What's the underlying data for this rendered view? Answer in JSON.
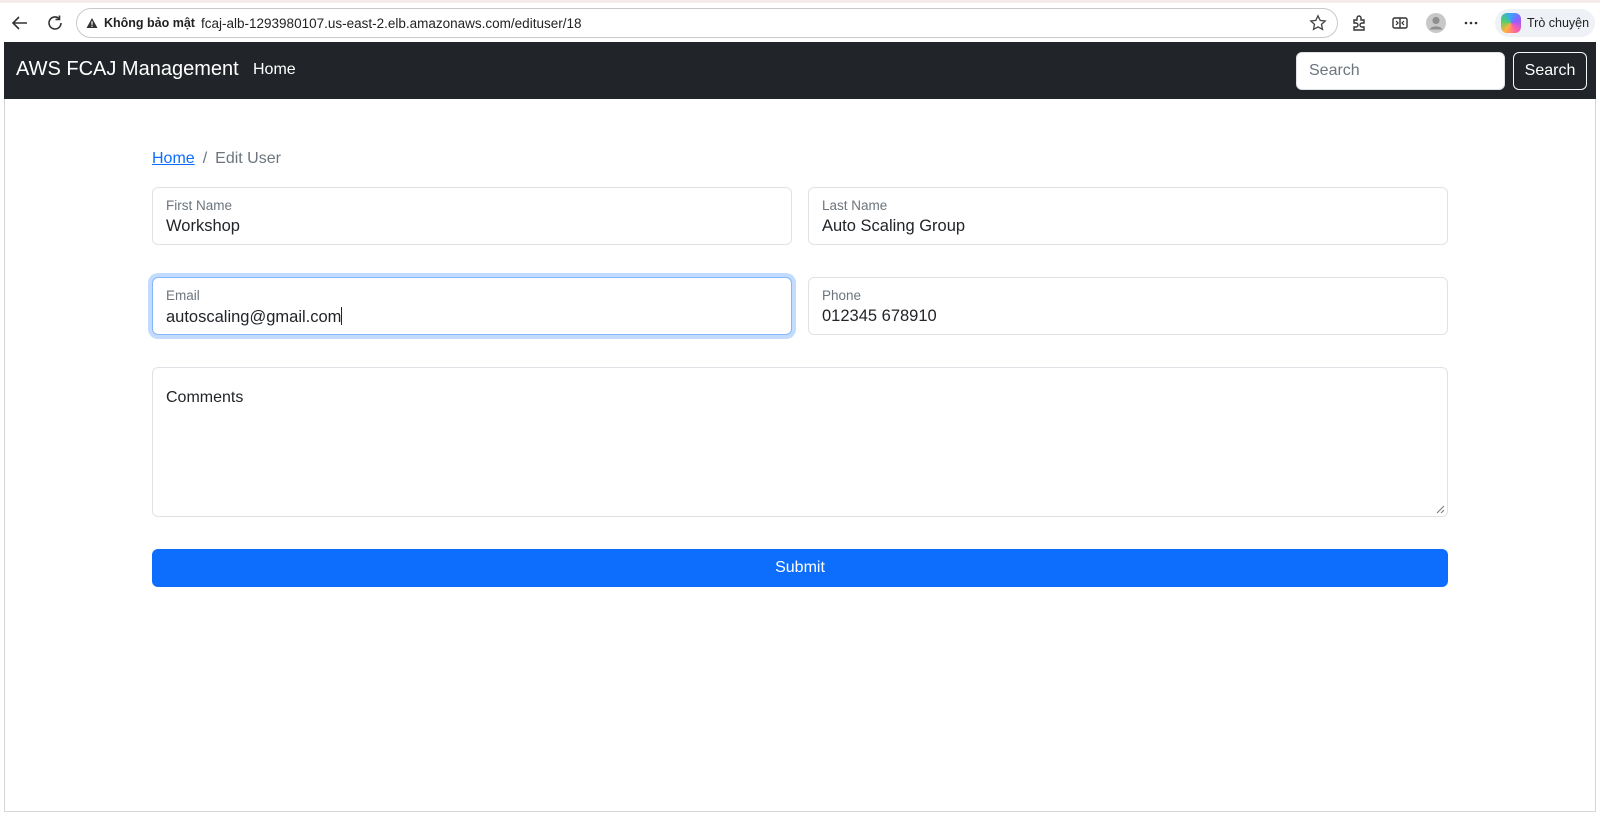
{
  "browser": {
    "security_label": "Không bảo mật",
    "url": "fcaj-alb-1293980107.us-east-2.elb.amazonaws.com/edituser/18",
    "copilot_label": "Trò chuyện"
  },
  "navbar": {
    "brand": "AWS FCAJ Management",
    "home_link": "Home",
    "search_placeholder": "Search",
    "search_button": "Search"
  },
  "breadcrumb": {
    "home": "Home",
    "separator": "/",
    "current": "Edit User"
  },
  "form": {
    "first_name": {
      "label": "First Name",
      "value": "Workshop"
    },
    "last_name": {
      "label": "Last Name",
      "value": "Auto Scaling Group"
    },
    "email": {
      "label": "Email",
      "value": "autoscaling@gmail.com"
    },
    "phone": {
      "label": "Phone",
      "value": "012345 678910"
    },
    "comments": {
      "label": "Comments",
      "value": ""
    },
    "submit": "Submit"
  },
  "colors": {
    "navbar_bg": "#212529",
    "primary": "#0d6efd",
    "link": "#0d6efd"
  },
  "icons": [
    "back-arrow-icon",
    "reload-icon",
    "warning-icon",
    "star-icon",
    "extensions-icon",
    "split-screen-icon",
    "profile-icon",
    "more-icon",
    "copilot-icon"
  ]
}
